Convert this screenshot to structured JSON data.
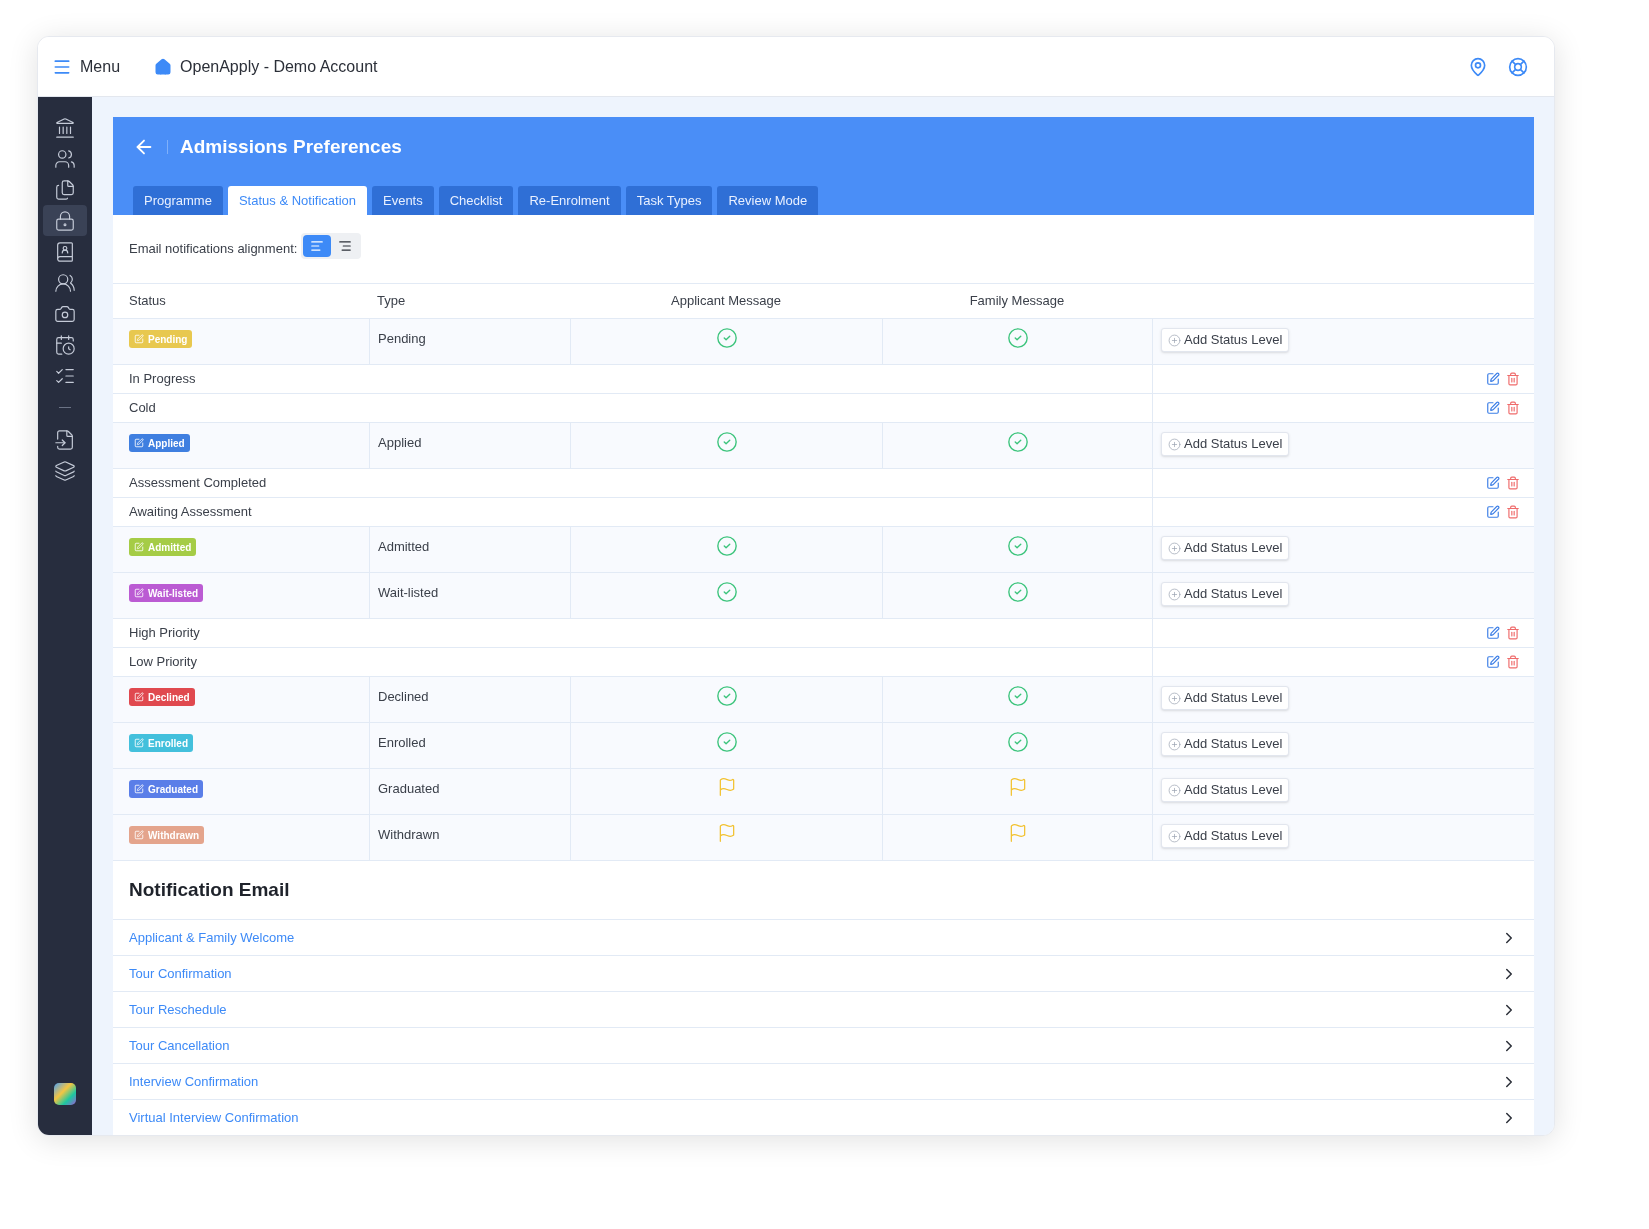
{
  "topbar": {
    "menu": "Menu",
    "account": "OpenApply - Demo Account"
  },
  "sidebar": {
    "groups": [
      [
        {
          "selected": false
        },
        {
          "selected": false
        },
        {
          "selected": false
        },
        {
          "selected": true
        },
        {
          "selected": false
        },
        {
          "selected": false
        },
        {
          "selected": false
        },
        {
          "selected": false
        },
        {
          "selected": false
        }
      ],
      [
        {
          "selected": false
        },
        {
          "selected": false
        }
      ]
    ]
  },
  "header": {
    "title": "Admissions Preferences"
  },
  "tabs": [
    {
      "label": "Programme",
      "selected": false
    },
    {
      "label": "Status & Notification",
      "selected": true
    },
    {
      "label": "Events",
      "selected": false
    },
    {
      "label": "Checklist",
      "selected": false
    },
    {
      "label": "Re-Enrolment",
      "selected": false
    },
    {
      "label": "Task Types",
      "selected": false
    },
    {
      "label": "Review Mode",
      "selected": false
    }
  ],
  "alignment": {
    "label": "Email notifications alignment:",
    "options": [
      {
        "selected": true
      },
      {
        "selected": false
      }
    ]
  },
  "table": {
    "columns": [
      "Status",
      "Type",
      "Applicant Message",
      "Family Message"
    ],
    "rows": [
      {
        "kind": "status",
        "badge": "Pending",
        "color": "#e8c84f",
        "type": "Pending",
        "applicant": {
          "kind": "check"
        },
        "family": {
          "kind": "check"
        },
        "action": "Add Status Level"
      },
      {
        "kind": "level",
        "name": "In Progress"
      },
      {
        "kind": "level",
        "name": "Cold"
      },
      {
        "kind": "status",
        "badge": "Applied",
        "color": "#3f7fe0",
        "type": "Applied",
        "applicant": {
          "kind": "check"
        },
        "family": {
          "kind": "check"
        },
        "action": "Add Status Level"
      },
      {
        "kind": "level",
        "name": "Assessment Completed"
      },
      {
        "kind": "level",
        "name": "Awaiting Assessment"
      },
      {
        "kind": "status",
        "badge": "Admitted",
        "color": "#a5cc46",
        "type": "Admitted",
        "applicant": {
          "kind": "check"
        },
        "family": {
          "kind": "check"
        },
        "action": "Add Status Level"
      },
      {
        "kind": "status",
        "badge": "Wait-listed",
        "color": "#bb5bd3",
        "type": "Wait-listed",
        "applicant": {
          "kind": "check"
        },
        "family": {
          "kind": "check"
        },
        "action": "Add Status Level"
      },
      {
        "kind": "level",
        "name": "High Priority"
      },
      {
        "kind": "level",
        "name": "Low Priority"
      },
      {
        "kind": "status",
        "badge": "Declined",
        "color": "#e0494f",
        "type": "Declined",
        "applicant": {
          "kind": "check"
        },
        "family": {
          "kind": "check"
        },
        "action": "Add Status Level"
      },
      {
        "kind": "status",
        "badge": "Enrolled",
        "color": "#43c0dc",
        "type": "Enrolled",
        "applicant": {
          "kind": "check"
        },
        "family": {
          "kind": "check"
        },
        "action": "Add Status Level"
      },
      {
        "kind": "status",
        "badge": "Graduated",
        "color": "#5a7ee8",
        "type": "Graduated",
        "applicant": {
          "kind": "flag"
        },
        "family": {
          "kind": "flag"
        },
        "action": "Add Status Level"
      },
      {
        "kind": "status",
        "badge": "Withdrawn",
        "color": "#e4a48c",
        "type": "Withdrawn",
        "applicant": {
          "kind": "flag"
        },
        "family": {
          "kind": "flag"
        },
        "action": "Add Status Level"
      }
    ]
  },
  "notification_email": {
    "title": "Notification Email",
    "items": [
      "Applicant & Family Welcome",
      "Tour Confirmation",
      "Tour Reschedule",
      "Tour Cancellation",
      "Interview Confirmation",
      "Virtual Interview Confirmation"
    ]
  }
}
